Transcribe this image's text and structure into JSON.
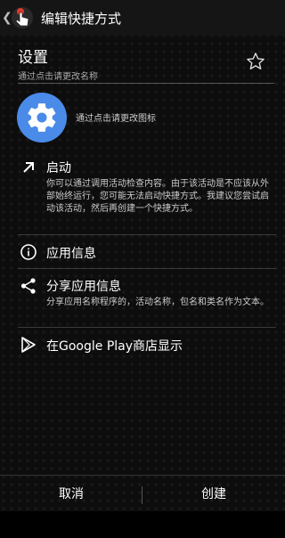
{
  "actionbar": {
    "title": "编辑快捷方式",
    "back_glyph": "❮",
    "app_icon": "hand-pointer-icon"
  },
  "header": {
    "name": "设置",
    "hint": "通过点击请更改名称",
    "star_icon": "star-outline-icon"
  },
  "icon_row": {
    "icon": "gear-icon",
    "hint": "通过点击请更改图标"
  },
  "sections": {
    "launch": {
      "icon": "arrow-up-right-icon",
      "title": "启动",
      "desc": "你可以通过调用活动检查内容。由于该活动是不应该从外部始终运行，您可能无法启动快捷方式。我建议您尝试启动该活动，然后再创建一个快捷方式。"
    },
    "app_info": {
      "icon": "info-icon",
      "title": "应用信息"
    },
    "share": {
      "icon": "share-icon",
      "title": "分享应用信息",
      "desc": "分享应用名称程序的，活动名称，包名和类名作为文本。"
    },
    "play": {
      "icon": "play-store-icon",
      "title": "在Google Play商店显示"
    }
  },
  "buttons": {
    "cancel": "取消",
    "create": "创建"
  },
  "colors": {
    "gear_bg": "#4a8ae8",
    "background": "#0d0d0d"
  }
}
